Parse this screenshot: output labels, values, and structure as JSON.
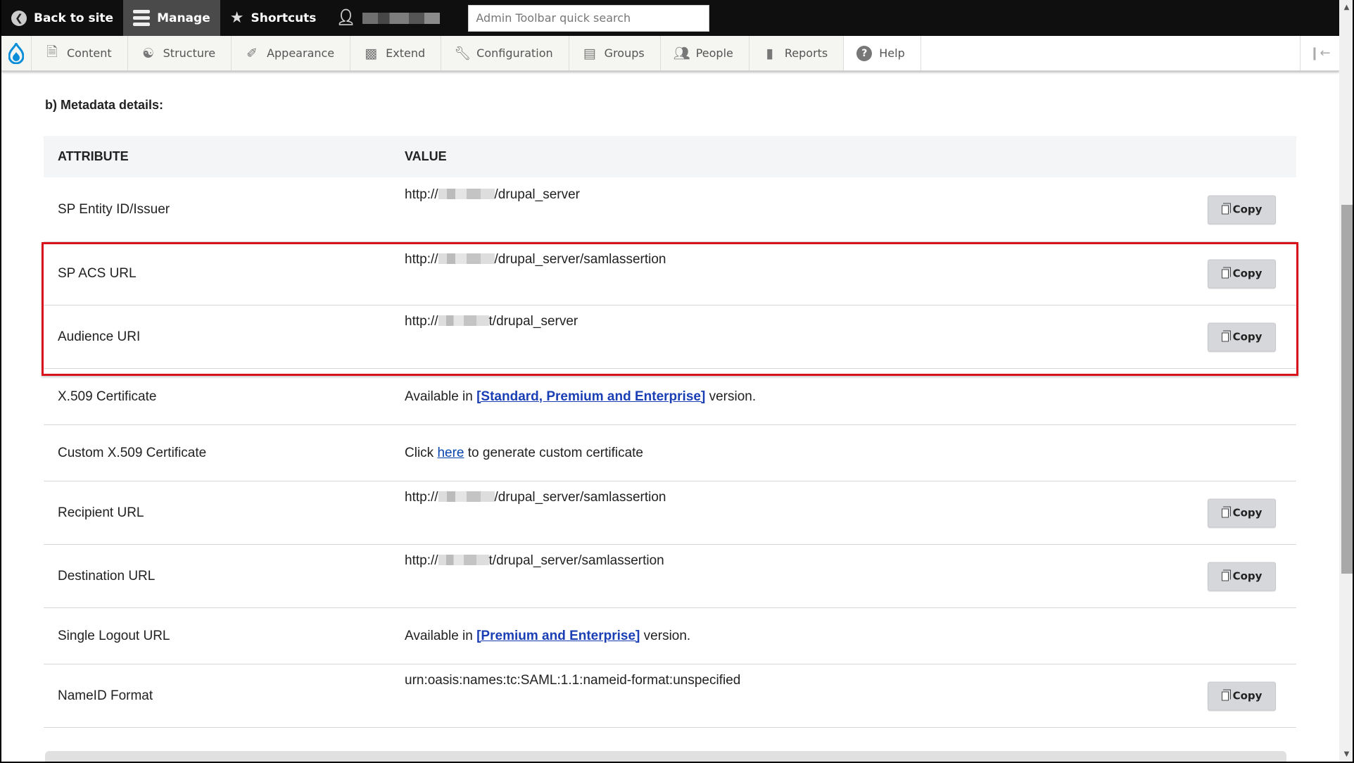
{
  "toolbar": {
    "back_to_site": "Back to site",
    "manage": "Manage",
    "shortcuts": "Shortcuts",
    "search_placeholder": "Admin Toolbar quick search"
  },
  "tray": {
    "items": [
      {
        "label": "Content",
        "icon": "file-icon"
      },
      {
        "label": "Structure",
        "icon": "sitemap-icon"
      },
      {
        "label": "Appearance",
        "icon": "paintbrush-icon"
      },
      {
        "label": "Extend",
        "icon": "puzzle-icon"
      },
      {
        "label": "Configuration",
        "icon": "wrench-icon"
      },
      {
        "label": "Groups",
        "icon": "groups-icon"
      },
      {
        "label": "People",
        "icon": "people-icon"
      },
      {
        "label": "Reports",
        "icon": "bar-chart-icon"
      },
      {
        "label": "Help",
        "icon": "help-icon"
      }
    ]
  },
  "section": {
    "title": "b) Metadata details:"
  },
  "table": {
    "headers": {
      "attribute": "ATTRIBUTE",
      "value": "VALUE"
    },
    "copy_label": "Copy",
    "rows": [
      {
        "attribute": "SP Entity ID/Issuer",
        "prefix": "http://",
        "suffix": "/drupal_server"
      },
      {
        "attribute": "SP ACS URL",
        "prefix": "http://",
        "suffix": "/drupal_server/samlassertion"
      },
      {
        "attribute": "Audience URI",
        "prefix": "http://",
        "suffix": "t/drupal_server"
      },
      {
        "attribute": "X.509 Certificate",
        "text_before": "Available in ",
        "link": "[Standard, Premium and Enterprise]",
        "text_after": " version."
      },
      {
        "attribute": "Custom X.509 Certificate",
        "text_before": "Click ",
        "link": "here",
        "text_after": " to generate custom certificate"
      },
      {
        "attribute": "Recipient URL",
        "prefix": "http://",
        "suffix": "/drupal_server/samlassertion"
      },
      {
        "attribute": "Destination URL",
        "prefix": "http://",
        "suffix": "t/drupal_server/samlassertion"
      },
      {
        "attribute": "Single Logout URL",
        "text_before": "Available in ",
        "link": "[Premium and Enterprise]",
        "text_after": " version."
      },
      {
        "attribute": "NameID Format",
        "value": "urn:oasis:names:tc:SAML:1.1:nameid-format:unspecified"
      }
    ]
  },
  "colors": {
    "highlight": "#d9121b",
    "link": "#0645ad",
    "toolbar_bg": "#0f0f0f",
    "drupal_blue": "#0a8ed9"
  }
}
